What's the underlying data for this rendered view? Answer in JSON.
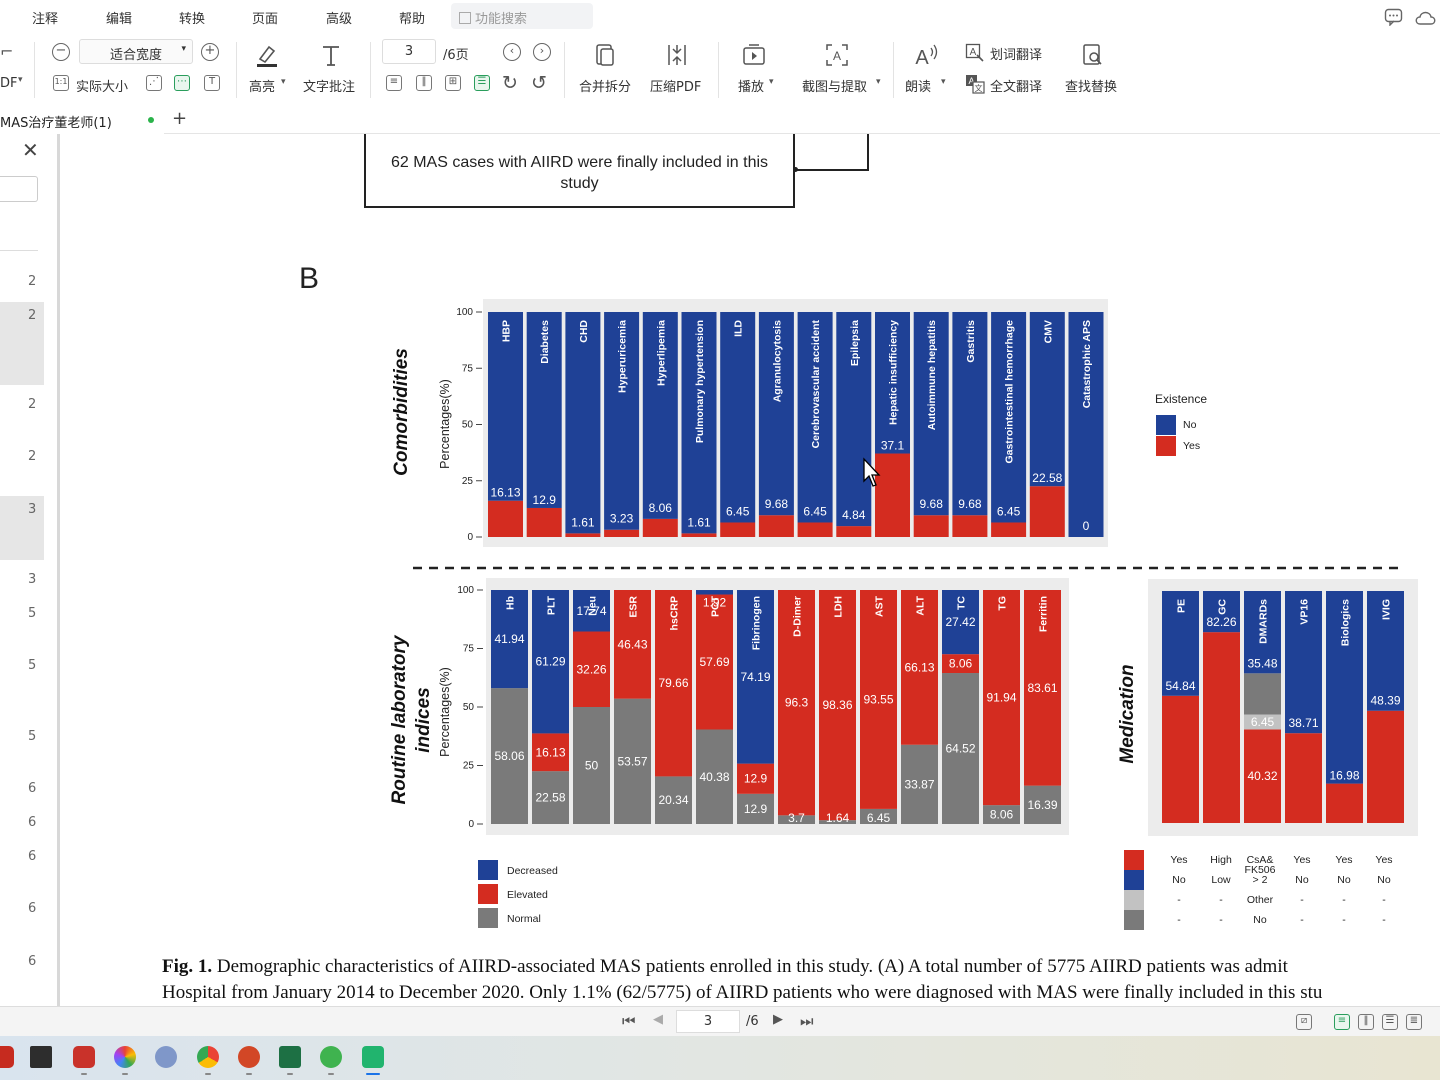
{
  "menu": {
    "items": [
      "注释",
      "编辑",
      "转换",
      "页面",
      "高级",
      "帮助"
    ],
    "search_placeholder": "功能搜索"
  },
  "toolbar": {
    "pdf_label": "DF",
    "actual_size": "实际大小",
    "fit_width": "适合宽度",
    "highlight": "高亮",
    "text_comment": "文字批注",
    "page_current": "3",
    "page_total": "/6页",
    "merge_split": "合并拆分",
    "compress_pdf": "压缩PDF",
    "play": "播放",
    "screenshot_extract": "截图与提取",
    "read_aloud": "朗读",
    "word_translate": "划词翻译",
    "full_translate": "全文翻译",
    "find_replace": "查找替换"
  },
  "tab": {
    "title": "MAS治疗董老师(1)"
  },
  "sidepanel": {
    "page_numbers": [
      "2",
      "2",
      "2",
      "2",
      "3",
      "3",
      "5",
      "5",
      "5",
      "6",
      "6",
      "6",
      "6",
      "6"
    ]
  },
  "document": {
    "flow_box_text": "62 MAS cases with AIIRD were finally included in this study",
    "panel_label": "B",
    "caption_line1_bold": "Fig. 1.",
    "caption_line1": " Demographic characteristics of AIIRD-associated MAS patients enrolled in this study. (A) A total number of 5775 AIIRD patients was admit",
    "caption_line2": "Hospital from January 2014 to December 2020. Only 1.1% (62/5775) of AIIRD patients who were diagnosed with MAS were finally included in this stu"
  },
  "statusbar": {
    "page_current": "3",
    "page_total": "/6"
  },
  "colors": {
    "blue": "#1f4196",
    "red": "#d42c20",
    "gray": "#7a7a7a",
    "light_gray": "#c2c2c2",
    "panel_bg": "#ececec"
  },
  "chart_data": [
    {
      "type": "bar",
      "title": "Comorbidities",
      "ylabel": "Percentages(%)",
      "ylim": [
        0,
        100
      ],
      "yticks": [
        "0",
        "25",
        "50",
        "75",
        "100"
      ],
      "categories": [
        "HBP",
        "Diabetes",
        "CHD",
        "Hyperuricemia",
        "Hyperlipemia",
        "Pulmonary hypertension",
        "ILD",
        "Agranulocytosis",
        "Cerebrovascular accident",
        "Epilepsia",
        "Hepatic insufficiency",
        "Autoimmune hepatitis",
        "Gastritis",
        "Gastrointestinal hemorrhage",
        "CMV",
        "Catastrophic APS"
      ],
      "series": [
        {
          "name": "Yes",
          "values": [
            16.13,
            12.9,
            1.61,
            3.23,
            8.06,
            1.61,
            6.45,
            9.68,
            6.45,
            4.84,
            37.1,
            9.68,
            9.68,
            6.45,
            22.58,
            0
          ]
        },
        {
          "name": "No",
          "values": [
            83.87,
            87.1,
            98.39,
            96.77,
            91.94,
            98.39,
            93.55,
            90.32,
            93.55,
            95.16,
            62.9,
            90.32,
            90.32,
            93.55,
            77.42,
            100
          ]
        }
      ],
      "labels": [
        "16.13",
        "12.9",
        "1.61",
        "3.23",
        "8.06",
        "1.61",
        "6.45",
        "9.68",
        "6.45",
        "4.84",
        "37.1",
        "9.68",
        "9.68",
        "6.45",
        "22.58",
        "0"
      ],
      "legend_title": "Existence",
      "legend": [
        "No",
        "Yes"
      ]
    },
    {
      "type": "bar",
      "title": "Routine laboratory indices",
      "ylabel": "Percentages(%)",
      "ylim": [
        0,
        100
      ],
      "yticks": [
        "0",
        "25",
        "50",
        "75",
        "100"
      ],
      "categories": [
        "Hb",
        "PLT",
        "Neu",
        "ESR",
        "hsCRP",
        "PCT",
        "Fibrinogen",
        "D-Dimer",
        "LDH",
        "AST",
        "ALT",
        "TC",
        "TG",
        "Ferritin"
      ],
      "series": [
        {
          "name": "Normal",
          "values": [
            58.06,
            22.58,
            50,
            53.57,
            20.34,
            40.38,
            12.9,
            3.7,
            1.64,
            6.45,
            33.87,
            64.52,
            8.06,
            16.39
          ]
        },
        {
          "name": "Elevated",
          "values": [
            0,
            16.13,
            32.26,
            46.43,
            79.66,
            57.69,
            12.9,
            96.3,
            98.36,
            93.55,
            66.13,
            8.06,
            91.94,
            83.61
          ]
        },
        {
          "name": "Decreased",
          "values": [
            41.94,
            61.29,
            17.74,
            0,
            0,
            1.92,
            74.19,
            0,
            0,
            0,
            0,
            27.42,
            0,
            0
          ]
        }
      ],
      "label_items": [
        [
          "41.94",
          "58.06"
        ],
        [
          "61.29",
          "16.13",
          "22.58"
        ],
        [
          "17.74",
          "32.26",
          "50"
        ],
        [
          "46.43",
          "53.57"
        ],
        [
          "79.66",
          "20.34"
        ],
        [
          "1.92",
          "57.69",
          "40.38"
        ],
        [
          "74.19",
          "12.9",
          "12.9"
        ],
        [
          "96.3",
          "3.7"
        ],
        [
          "98.36",
          "1.64"
        ],
        [
          "93.55",
          "6.45"
        ],
        [
          "66.13",
          "33.87"
        ],
        [
          "27.42",
          "8.06",
          "64.52"
        ],
        [
          "91.94",
          "8.06"
        ],
        [
          "83.61",
          "16.39"
        ]
      ],
      "legend": [
        "Decreased",
        "Elevated",
        "Normal"
      ]
    },
    {
      "type": "bar",
      "title": "Medication",
      "categories": [
        "PE",
        "GC",
        "DMARDs",
        "VP16",
        "Biologics",
        "IVIG"
      ],
      "series": [
        {
          "name": "red",
          "values": [
            54.84,
            82.26,
            40.32,
            38.71,
            16.98,
            48.39
          ]
        },
        {
          "name": "light_gray",
          "values": [
            0,
            0,
            6.45,
            0,
            0,
            0
          ]
        },
        {
          "name": "gray",
          "values": [
            0,
            0,
            17.75,
            0,
            0,
            0
          ]
        },
        {
          "name": "blue",
          "values": [
            45.16,
            17.74,
            35.48,
            61.29,
            83.02,
            51.61
          ]
        }
      ],
      "label_items": [
        [
          "54.84"
        ],
        [
          "82.26"
        ],
        [
          "35.48",
          "6.45",
          "40.32"
        ],
        [
          "38.71"
        ],
        [
          "16.98"
        ],
        [
          "48.39"
        ]
      ],
      "legend_table": [
        [
          "Yes",
          "High",
          "CsA& FK506 > 2",
          "Yes",
          "Yes",
          "Yes"
        ],
        [
          "No",
          "Low",
          "-",
          "No",
          "No",
          "No"
        ],
        [
          "-",
          "-",
          "Other",
          "-",
          "-",
          "-"
        ],
        [
          "-",
          "-",
          "No",
          "-",
          "-",
          "-"
        ]
      ],
      "legend_table_rows": [
        [
          "Yes",
          "High",
          "CsA&",
          "Yes",
          "Yes",
          "Yes"
        ],
        [
          "No",
          "Low",
          "> 2",
          "No",
          "No",
          "No"
        ],
        [
          "-",
          "-",
          "Other",
          "-",
          "-",
          "-"
        ],
        [
          "-",
          "-",
          "No",
          "-",
          "-",
          "-"
        ]
      ],
      "legend_fk": "FK506"
    }
  ]
}
